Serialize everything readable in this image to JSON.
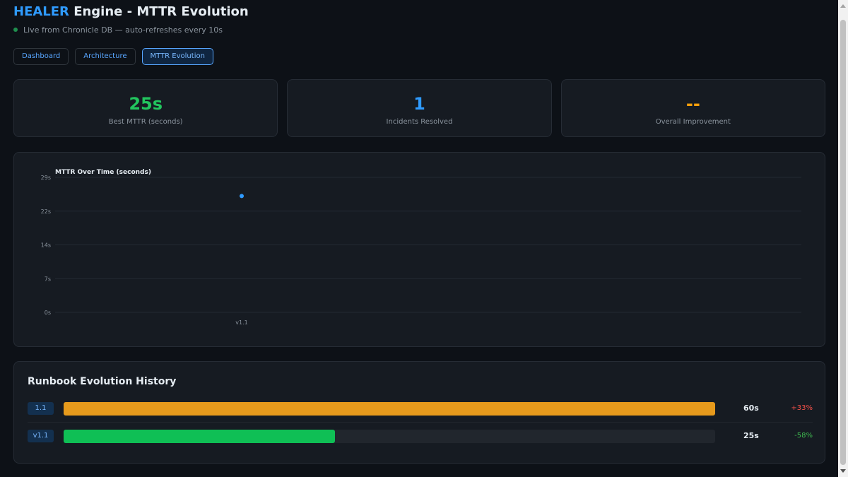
{
  "header": {
    "brand": "HEALER",
    "title_rest": " Engine - MTTR Evolution",
    "subtitle": "Live from Chronicle DB — auto-refreshes every 10s"
  },
  "tabs": [
    {
      "label": "Dashboard",
      "active": false
    },
    {
      "label": "Architecture",
      "active": false
    },
    {
      "label": "MTTR Evolution",
      "active": true
    }
  ],
  "stats": [
    {
      "value": "25s",
      "label": "Best MTTR (seconds)",
      "color": "#22c55e"
    },
    {
      "value": "1",
      "label": "Incidents Resolved",
      "color": "#2f9bff"
    },
    {
      "value": "--",
      "label": "Overall Improvement",
      "color": "#f59e0b"
    }
  ],
  "chart_data": {
    "type": "scatter",
    "title": "MTTR Over Time (seconds)",
    "categories": [
      "v1.1"
    ],
    "series": [
      {
        "values": [
          25
        ],
        "color": "#2f9bff"
      }
    ],
    "yticks": [
      "29s",
      "22s",
      "14s",
      "7s",
      "0s"
    ],
    "ylim": [
      0,
      29
    ],
    "grid": true
  },
  "runbook": {
    "title": "Runbook Evolution History",
    "rows": [
      {
        "version": "1.1",
        "fill": 1.0,
        "color": "#e69a1c",
        "time": "60s",
        "delta": "+33%",
        "delta_color": "#f85149"
      },
      {
        "version": "v1.1",
        "fill": 0.416,
        "color": "#0fbf55",
        "time": "25s",
        "delta": "-58%",
        "delta_color": "#3fb950"
      }
    ]
  }
}
